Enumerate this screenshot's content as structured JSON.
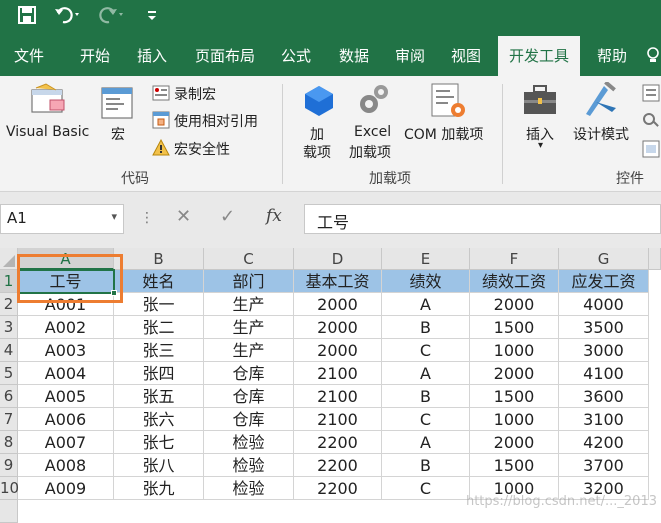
{
  "quick_access": {
    "save_icon": "save-icon",
    "undo_icon": "undo-icon",
    "redo_icon": "redo-icon",
    "customize_icon": "customize-icon"
  },
  "tabs": [
    "文件",
    "开始",
    "插入",
    "页面布局",
    "公式",
    "数据",
    "审阅",
    "视图",
    "开发工具",
    "帮助"
  ],
  "active_tab": "开发工具",
  "ribbon": {
    "visual_basic": "Visual Basic",
    "macros": "宏",
    "record_macro": "录制宏",
    "relative_ref": "使用相对引用",
    "macro_security": "宏安全性",
    "group_code": "代码",
    "addins_1": "加",
    "addins_2": "载项",
    "excel_addins_1": "Excel",
    "excel_addins_2": "加载项",
    "com_addins": "COM 加载项",
    "group_addins": "加载项",
    "insert": "插入",
    "design_mode": "设计模式",
    "group_controls": "控件"
  },
  "formula_bar": {
    "name_box": "A1",
    "fx": "fx",
    "value": "工号"
  },
  "columns": [
    "A",
    "B",
    "C",
    "D",
    "E",
    "F",
    "G"
  ],
  "rows": [
    "1",
    "2",
    "3",
    "4",
    "5",
    "6",
    "7",
    "8",
    "9",
    "10"
  ],
  "table": {
    "headers": [
      "工号",
      "姓名",
      "部门",
      "基本工资",
      "绩效",
      "绩效工资",
      "应发工资"
    ],
    "data": [
      [
        "A001",
        "张一",
        "生产",
        "2000",
        "A",
        "2000",
        "4000"
      ],
      [
        "A002",
        "张二",
        "生产",
        "2000",
        "B",
        "1500",
        "3500"
      ],
      [
        "A003",
        "张三",
        "生产",
        "2000",
        "C",
        "1000",
        "3000"
      ],
      [
        "A004",
        "张四",
        "仓库",
        "2100",
        "A",
        "2000",
        "4100"
      ],
      [
        "A005",
        "张五",
        "仓库",
        "2100",
        "B",
        "1500",
        "3600"
      ],
      [
        "A006",
        "张六",
        "仓库",
        "2100",
        "C",
        "1000",
        "3100"
      ],
      [
        "A007",
        "张七",
        "检验",
        "2200",
        "A",
        "2000",
        "4200"
      ],
      [
        "A008",
        "张八",
        "检验",
        "2200",
        "B",
        "1500",
        "3700"
      ],
      [
        "A009",
        "张九",
        "检验",
        "2200",
        "C",
        "1000",
        "3200"
      ]
    ]
  },
  "colors": {
    "ribbon_green": "#217346",
    "header_fill": "#9dc3e6",
    "highlight": "#ed7d31"
  }
}
